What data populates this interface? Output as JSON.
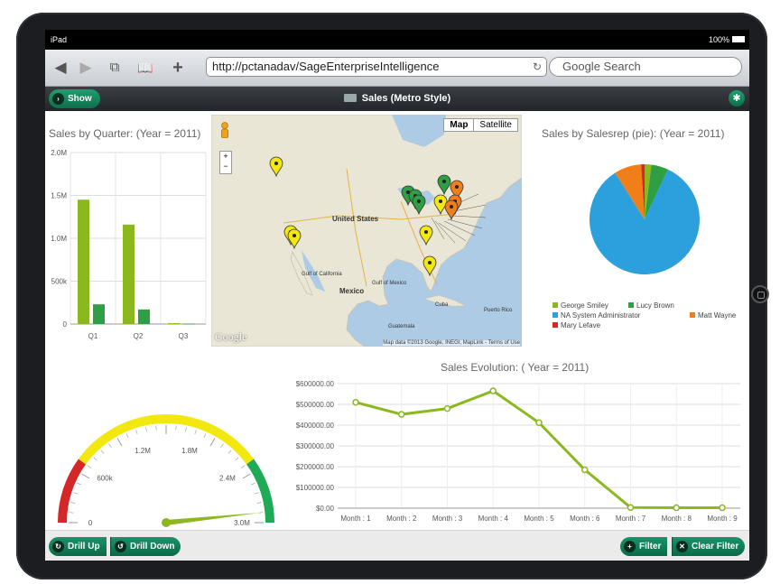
{
  "device": {
    "carrier": "iPad",
    "battery": "100%"
  },
  "browser": {
    "url": "http://pctanadav/SageEnterpriseIntelligence",
    "search_placeholder": "Google Search"
  },
  "toolbar": {
    "show_label": "Show",
    "title": "Sales (Metro Style)"
  },
  "bar_chart": {
    "title": "Sales by Quarter: (Year = 2011)"
  },
  "map": {
    "map_label": "Map",
    "satellite_label": "Satellite",
    "attribution": "Map data ©2013 Google, INEGI, MapLink - Terms of Use",
    "logo": "Google",
    "labels": {
      "united_states": "United States",
      "mexico": "Mexico",
      "gulf_california": "Gulf of California",
      "gulf_mexico": "Gulf of Mexico",
      "cuba": "Cuba",
      "guatemala": "Guatemala",
      "puerto_rico": "Puerto Rico"
    }
  },
  "pie_chart": {
    "title": "Sales by Salesrep (pie): (Year = 2011)"
  },
  "gauge": {
    "value": 2.9,
    "max": 3.0
  },
  "line_chart": {
    "title": "Sales Evolution: ( Year = 2011)"
  },
  "bottom": {
    "drill_up": "Drill Up",
    "drill_down": "Drill Down",
    "filter": "Filter",
    "clear_filter": "Clear Filter"
  },
  "colors": {
    "accent": "#0d7c55",
    "lime": "#8cb81f",
    "green": "#2ea043",
    "blue": "#2ca0dc",
    "orange": "#f07f19",
    "red": "#d62728",
    "yellow": "#f2e80f"
  },
  "chart_data": [
    {
      "type": "bar",
      "title": "Sales by Quarter: (Year = 2011)",
      "categories": [
        "Q1",
        "Q2",
        "Q3"
      ],
      "series": [
        {
          "values": [
            1450000,
            1160000,
            10000
          ]
        },
        {
          "values": [
            230000,
            170000,
            5000
          ]
        }
      ],
      "ylim": [
        0,
        2000000
      ],
      "ytick_labels": [
        "0",
        "500k",
        "1.0M",
        "1.5M",
        "2.0M"
      ],
      "grid": true
    },
    {
      "type": "pie",
      "title": "Sales by Salesrep (pie): (Year = 2011)",
      "slices": [
        {
          "name": "George Smiley",
          "value": 2
        },
        {
          "name": "Lucy Brown",
          "value": 5
        },
        {
          "name": "NA System Administrator",
          "value": 84
        },
        {
          "name": "Matt Wayne",
          "value": 8
        },
        {
          "name": "Mary Lefave",
          "value": 1
        }
      ],
      "legend": "bottom"
    },
    {
      "type": "gauge",
      "min": 0,
      "max": 3000000,
      "value": 2900000,
      "tick_labels": [
        "0",
        "600k",
        "1.2M",
        "1.8M",
        "2.4M",
        "3.0M"
      ]
    },
    {
      "type": "line",
      "title": "Sales Evolution: ( Year = 2011)",
      "categories": [
        "Month : 1",
        "Month : 2",
        "Month : 3",
        "Month : 4",
        "Month : 5",
        "Month : 6",
        "Month : 7",
        "Month : 8",
        "Month : 9"
      ],
      "values": [
        510000,
        452000,
        480000,
        565000,
        412000,
        185000,
        3000,
        2000,
        2000
      ],
      "ylim": [
        0,
        600000
      ],
      "ytick_labels": [
        "$0.00",
        "$100000.00",
        "$200000.00",
        "$300000.00",
        "$400000.00",
        "$500000.00",
        "$600000.00"
      ],
      "grid": true
    }
  ]
}
